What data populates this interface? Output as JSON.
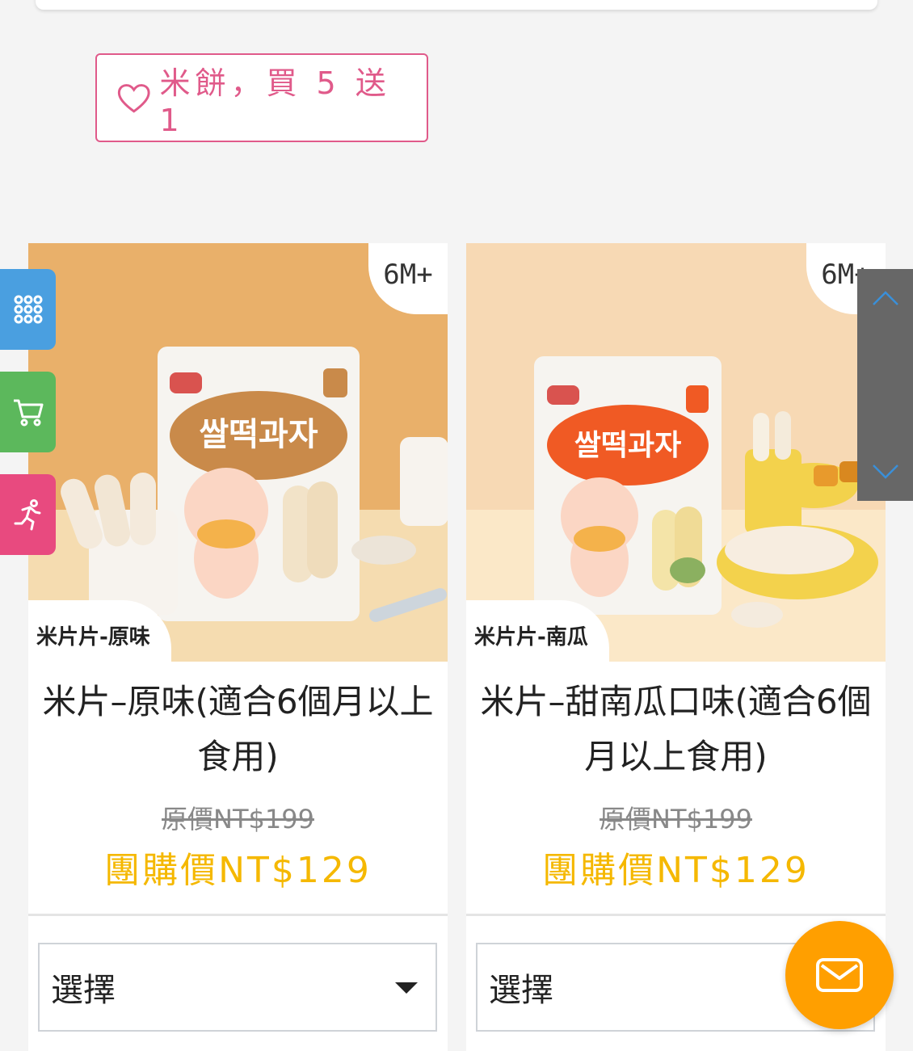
{
  "promo": {
    "label": "米餅，買 5 送 1"
  },
  "products": [
    {
      "age_badge": "6M+",
      "image_label": "米片片-原味",
      "title": "米片–原味(適合6個月以上食用)",
      "original_price": "原價NT$199",
      "group_price": "團購價NT$129",
      "select": {
        "value": "選擇"
      }
    },
    {
      "age_badge": "6M+",
      "image_label": "米片片-南瓜",
      "title": "米片–甜南瓜口味(適合6個月以上食用)",
      "original_price": "原價NT$199",
      "group_price": "團購價NT$129",
      "select": {
        "value": "選擇"
      }
    }
  ],
  "side_buttons": [
    {
      "icon": "grid-icon",
      "color": "#4a9fe0"
    },
    {
      "icon": "cart-icon",
      "color": "#5cb85c"
    },
    {
      "icon": "running-person-icon",
      "color": "#e84a7f"
    }
  ],
  "colors": {
    "accent_pink": "#e05a8a",
    "price_yellow": "#f5b800",
    "fab_orange": "#ff9f00"
  }
}
